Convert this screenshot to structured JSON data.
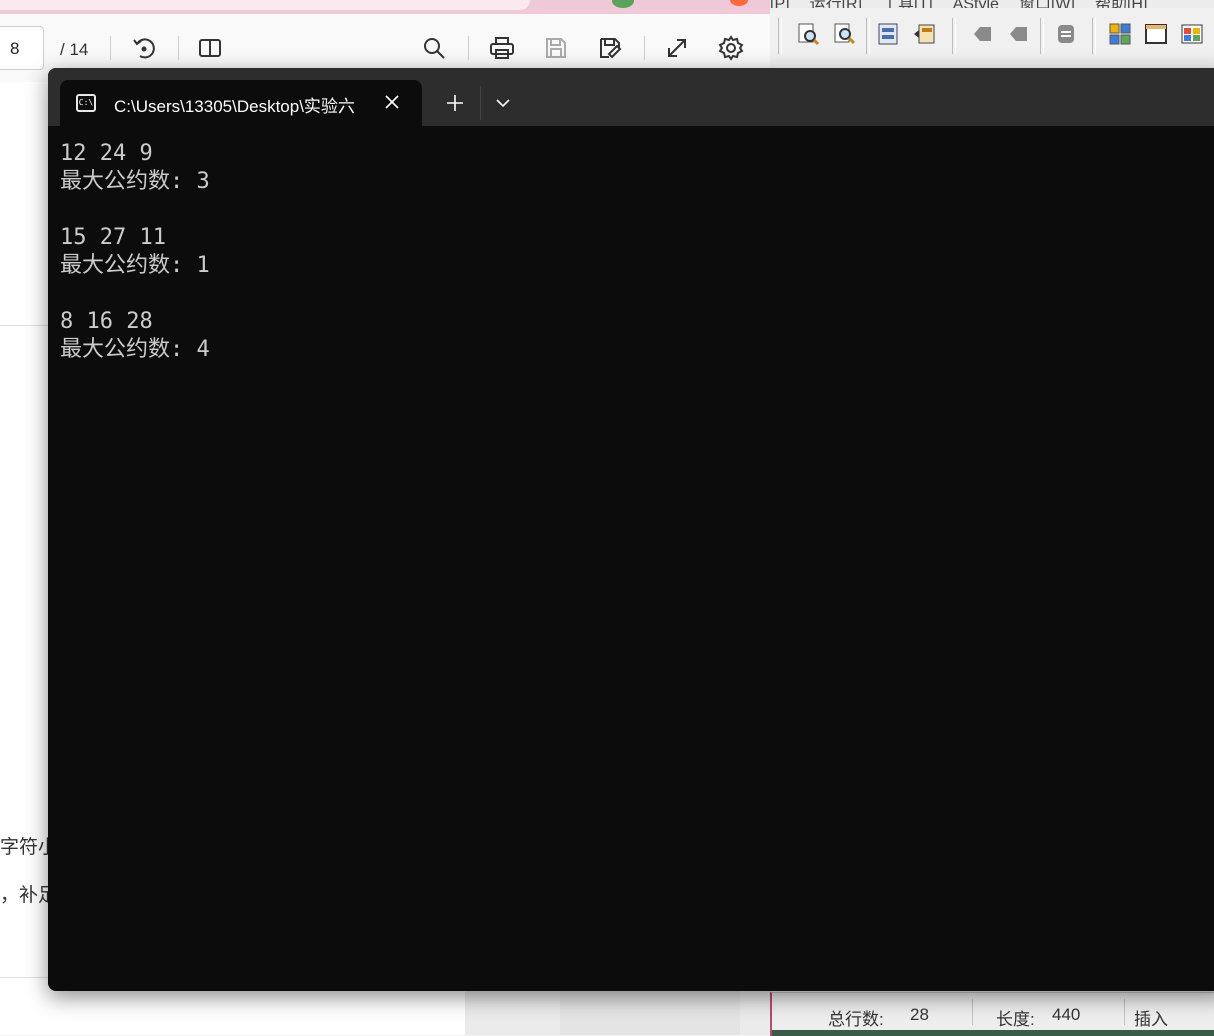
{
  "pdf_viewer": {
    "page_current": "8",
    "page_total": "/ 14",
    "snippet_line1": "字符小",
    "snippet_line2": "，补足"
  },
  "devcpp": {
    "menu_items": [
      "[P]",
      "运行[R]",
      "工具[T]",
      "AStyle",
      "窗口[W]",
      "帮助[H]"
    ],
    "status": {
      "total_lines_label": "总行数:",
      "total_lines_value": "28",
      "length_label": "长度:",
      "length_value": "440",
      "mode": "插入"
    }
  },
  "terminal": {
    "tab_title": "C:\\Users\\13305\\Desktop\\实验六",
    "tab_icon_text": "C:\\",
    "colors": {
      "background": "#0c0c0c",
      "titlebar": "#2d2d2d",
      "text": "#cccccc"
    },
    "lines": [
      "12 24 9",
      "最大公约数: 3",
      "",
      "15 27 11",
      "最大公约数: 1",
      "",
      "8 16 28",
      "最大公约数: 4"
    ]
  }
}
